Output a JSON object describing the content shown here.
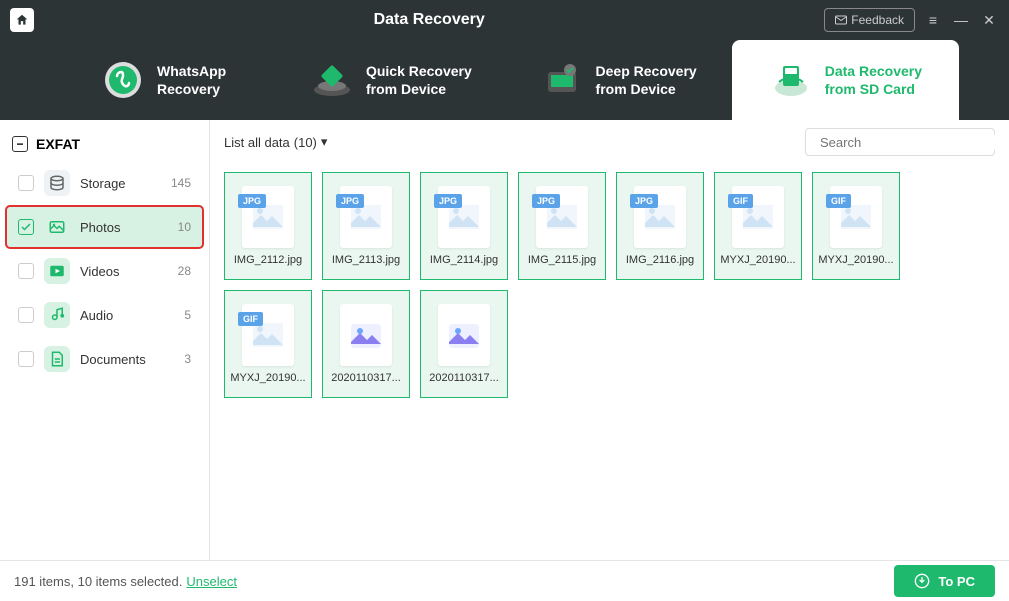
{
  "app": {
    "title": "Data Recovery"
  },
  "titlebar": {
    "feedback": "Feedback"
  },
  "tabs": [
    {
      "line1": "WhatsApp",
      "line2": "Recovery",
      "active": false
    },
    {
      "line1": "Quick Recovery",
      "line2": "from Device",
      "active": false
    },
    {
      "line1": "Deep Recovery",
      "line2": "from Device",
      "active": false
    },
    {
      "line1": "Data Recovery",
      "line2": "from SD Card",
      "active": true
    }
  ],
  "sidebar": {
    "volume": "EXFAT",
    "items": [
      {
        "label": "Storage",
        "count": "145",
        "checked": false,
        "selected": false,
        "icon": "storage"
      },
      {
        "label": "Photos",
        "count": "10",
        "checked": true,
        "selected": true,
        "highlighted": true,
        "icon": "photos"
      },
      {
        "label": "Videos",
        "count": "28",
        "checked": false,
        "selected": false,
        "icon": "videos"
      },
      {
        "label": "Audio",
        "count": "5",
        "checked": false,
        "selected": false,
        "icon": "audio"
      },
      {
        "label": "Documents",
        "count": "3",
        "checked": false,
        "selected": false,
        "icon": "docs"
      }
    ]
  },
  "toolbar": {
    "filter_label": "List all data",
    "filter_count": "(10)",
    "search_placeholder": "Search"
  },
  "files": [
    {
      "name": "IMG_2112.jpg",
      "badge": "JPG",
      "type": "jpg"
    },
    {
      "name": "IMG_2113.jpg",
      "badge": "JPG",
      "type": "jpg"
    },
    {
      "name": "IMG_2114.jpg",
      "badge": "JPG",
      "type": "jpg"
    },
    {
      "name": "IMG_2115.jpg",
      "badge": "JPG",
      "type": "jpg"
    },
    {
      "name": "IMG_2116.jpg",
      "badge": "JPG",
      "type": "jpg"
    },
    {
      "name": "MYXJ_20190...",
      "badge": "GIF",
      "type": "gif"
    },
    {
      "name": "MYXJ_20190...",
      "badge": "GIF",
      "type": "gif"
    },
    {
      "name": "MYXJ_20190...",
      "badge": "GIF",
      "type": "gif"
    },
    {
      "name": "2020110317...",
      "badge": "",
      "type": "other"
    },
    {
      "name": "2020110317...",
      "badge": "",
      "type": "other"
    }
  ],
  "footer": {
    "status": "191 items, 10 items selected.",
    "unselect": "Unselect",
    "to_pc": "To PC"
  },
  "colors": {
    "accent": "#1fb96e",
    "header": "#2d3436"
  }
}
